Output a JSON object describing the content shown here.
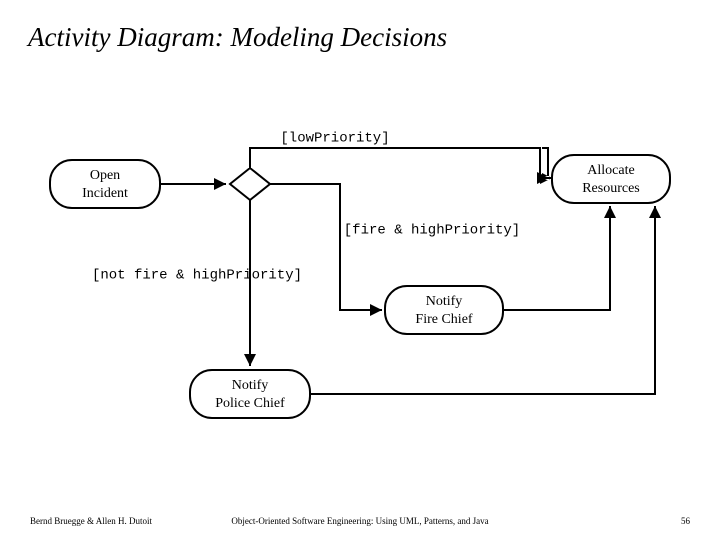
{
  "title": "Activity Diagram: Modeling Decisions",
  "nodes": {
    "open_incident": {
      "line1": "Open",
      "line2": "Incident"
    },
    "allocate_resources": {
      "line1": "Allocate",
      "line2": "Resources"
    },
    "notify_fire_chief": {
      "line1": "Notify",
      "line2": "Fire Chief"
    },
    "notify_police_chief": {
      "line1": "Notify",
      "line2": "Police Chief"
    }
  },
  "guards": {
    "low_priority": "[lowPriority]",
    "fire_high": "[fire & highPriority]",
    "not_fire_high": "[not fire & highPriority]"
  },
  "footer": {
    "authors": "Bernd Bruegge & Allen H. Dutoit",
    "book": "Object-Oriented Software Engineering: Using UML, Patterns, and Java",
    "page": "56"
  }
}
